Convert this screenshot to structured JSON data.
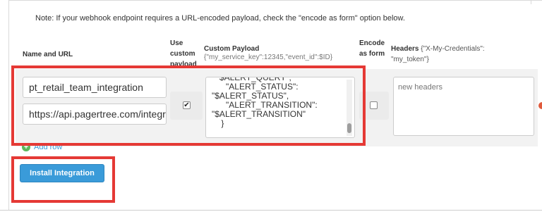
{
  "note": "Note: If your webhook endpoint requires a URL-encoded payload, check the \"encode as form\" option below.",
  "columns": {
    "name_url": "Name and URL",
    "use_custom_payload": "Use custom payload",
    "custom_payload": "Custom Payload",
    "custom_payload_hint": "{\"my_service_key\":12345,\"event_id\":$ID}",
    "encode_as_form": "Encode as form",
    "headers": "Headers",
    "headers_hint": "{\"X-My-Credentials\": \"my_token\"}"
  },
  "row": {
    "name_value": "pt_retail_team_integration",
    "url_value": "https://api.pagertree.com/integration",
    "use_custom_payload_checked": true,
    "custom_payload_text": "  \"$ALERT_QUERY\",\n      \"ALERT_STATUS\":\n\"$ALERT_STATUS\",\n      \"ALERT_TRANSITION\":\n\"$ALERT_TRANSITION\"\n    }",
    "encode_as_form_checked": false,
    "headers_placeholder": "new headers"
  },
  "add_row_label": "Add row",
  "install_button_label": "Install Integration",
  "colors": {
    "highlight": "#e53935",
    "button": "#3a9bd9",
    "add_icon": "#5cb85c"
  }
}
